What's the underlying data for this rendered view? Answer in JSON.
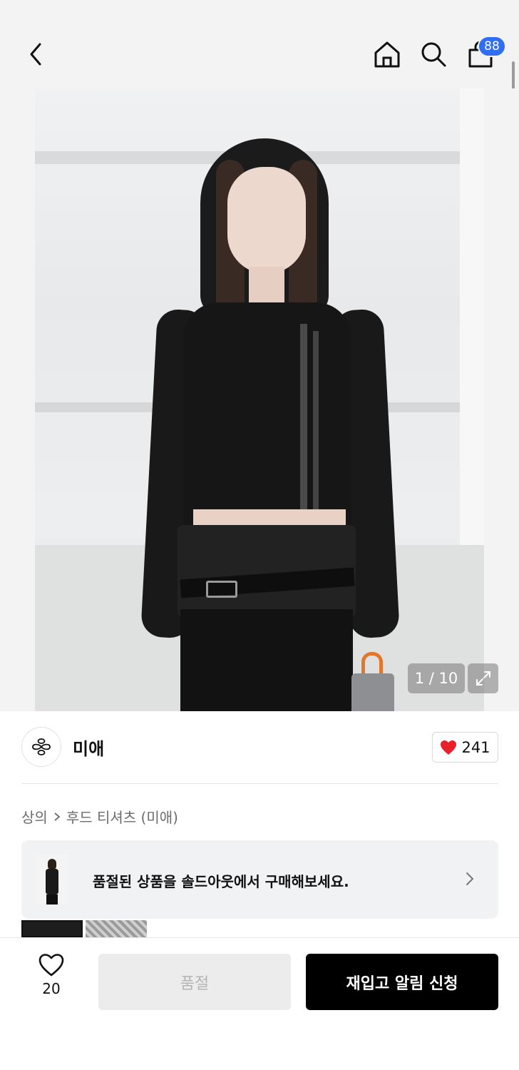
{
  "header": {
    "cart_badge": "88",
    "icons": [
      "chevron-left-icon",
      "home-icon",
      "search-icon",
      "shopping-bag-icon"
    ]
  },
  "gallery": {
    "counter": "1 / 10",
    "expand_icon": "expand-icon"
  },
  "brand": {
    "name": "미애",
    "likes": "241",
    "like_color": "#e8202a"
  },
  "breadcrumb": {
    "category": "상의",
    "subcategory": "후드 티셔츠 (미애)"
  },
  "soldout_banner": {
    "text": "품절된 상품을 솔드아웃에서 구매해보세요."
  },
  "bottom_bar": {
    "wish_count": "20",
    "soldout_label": "품절",
    "restock_label": "재입고 알림 신청"
  },
  "colors": {
    "badge": "#2f6ff3",
    "primary_button": "#000000",
    "disabled_button": "#ececec"
  }
}
